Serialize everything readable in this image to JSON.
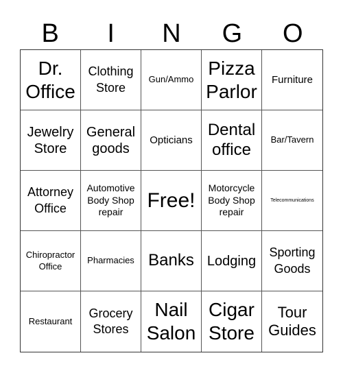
{
  "header": {
    "letters": [
      "B",
      "I",
      "N",
      "G",
      "O"
    ]
  },
  "board": {
    "rows": [
      [
        "Dr. Office",
        "Clothing Store",
        "Gun/Ammo",
        "Pizza Parlor",
        "Furniture"
      ],
      [
        "Jewelry Store",
        "General goods",
        "Opticians",
        "Dental office",
        "Bar/Tavern"
      ],
      [
        "Attorney Office",
        "Automotive Body Shop repair",
        "Free!",
        "Motorcycle Body Shop repair",
        "Telecommunications"
      ],
      [
        "Chiropractor Office",
        "Pharmacies",
        "Banks",
        "Lodging",
        "Sporting Goods"
      ],
      [
        "Restaurant",
        "Grocery Stores",
        "Nail Salon",
        "Cigar Store",
        "Tour Guides"
      ]
    ],
    "free_space": {
      "row": 2,
      "col": 2,
      "label": "Free!"
    }
  },
  "colors": {
    "background": "#ffffff",
    "text": "#000000",
    "grid_line": "#555555"
  }
}
